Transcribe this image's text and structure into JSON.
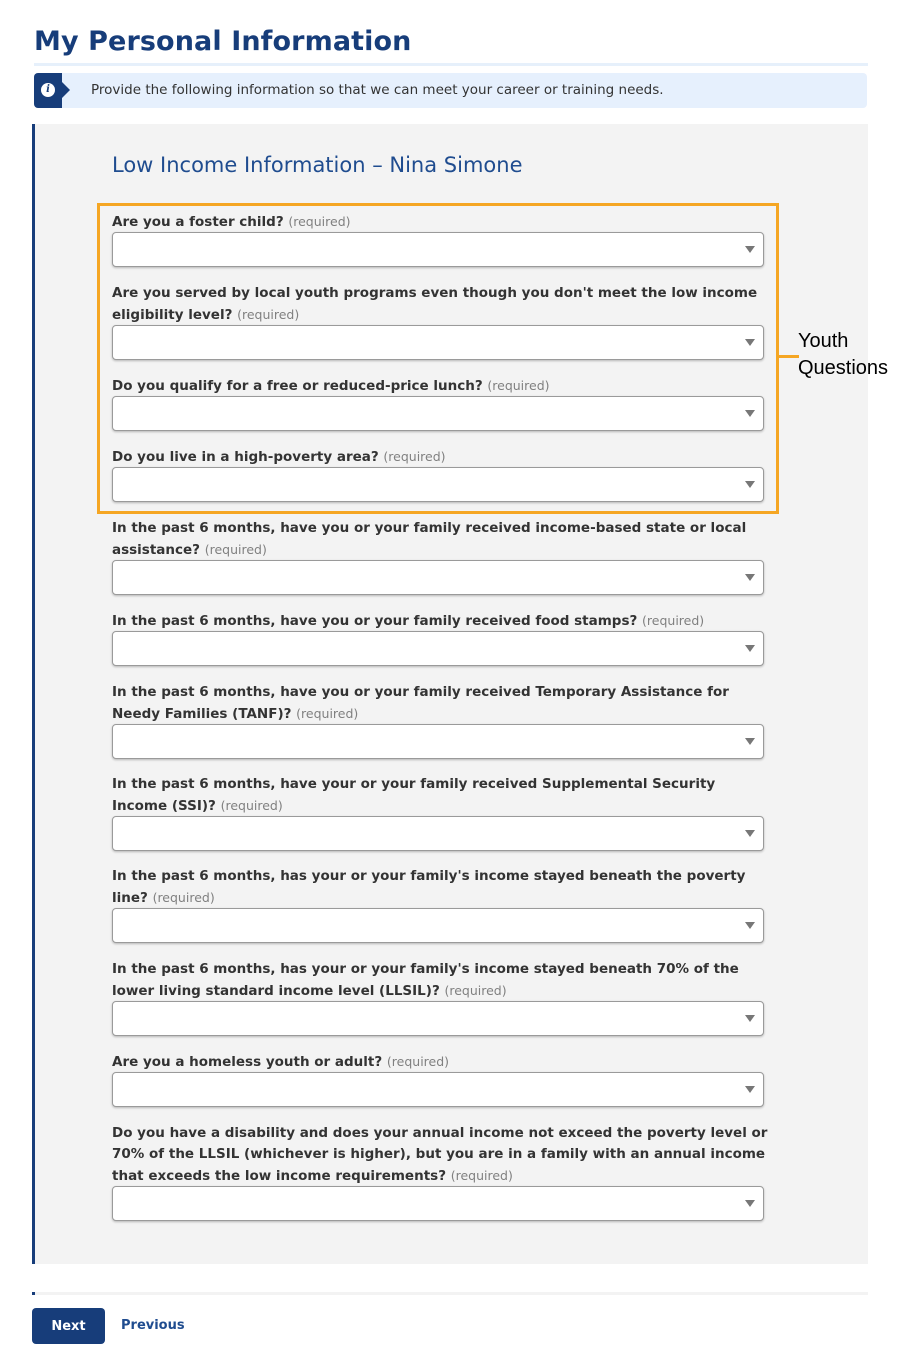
{
  "page": {
    "title": "My Personal Information"
  },
  "info_banner": {
    "icon": "info-icon",
    "icon_glyph": "i",
    "text": "Provide the following information so that we can meet your career or training needs."
  },
  "section": {
    "title": "Low Income Information – Nina Simone"
  },
  "annotation": {
    "line1": "Youth",
    "line2": "Questions",
    "color": "#f5a623"
  },
  "questions": [
    {
      "label": "Are you a foster child?",
      "required": "(required)",
      "value": "",
      "youth": true
    },
    {
      "label": "Are you served by local youth programs even though you don't meet the low income eligibility level?",
      "required": "(required)",
      "value": "",
      "youth": true
    },
    {
      "label": "Do you qualify for a free or reduced-price lunch?",
      "required": "(required)",
      "value": "",
      "youth": true
    },
    {
      "label": "Do you live in a high-poverty area?",
      "required": "(required)",
      "value": "",
      "youth": true
    },
    {
      "label": "In the past 6 months, have you or your family received income-based state or local assistance?",
      "required": "(required)",
      "value": "",
      "youth": false
    },
    {
      "label": "In the past 6 months, have you or your family received food stamps?",
      "required": "(required)",
      "value": "",
      "youth": false
    },
    {
      "label": "In the past 6 months, have you or your family received Temporary Assistance for Needy Families (TANF)?",
      "required": "(required)",
      "value": "",
      "youth": false
    },
    {
      "label": "In the past 6 months, have your or your family received Supplemental Security Income (SSI)?",
      "required": "(required)",
      "value": "",
      "youth": false
    },
    {
      "label": "In the past 6 months, has your or your family's income stayed beneath the poverty line?",
      "required": "(required)",
      "value": "",
      "youth": false
    },
    {
      "label": "In the past 6 months, has your or your family's income stayed beneath 70% of the lower living standard income level (LLSIL)?",
      "required": "(required)",
      "value": "",
      "youth": false
    },
    {
      "label": "Are you a homeless youth or adult?",
      "required": "(required)",
      "value": "",
      "youth": false
    },
    {
      "label": "Do you have a disability and does your annual income not exceed the poverty level or 70% of the LLSIL (whichever is higher), but you are in a family with an annual income that exceeds the low income requirements?",
      "required": "(required)",
      "value": "",
      "youth": false
    }
  ],
  "footer": {
    "next_label": "Next",
    "previous_label": "Previous"
  },
  "colors": {
    "brand": "#173d7a",
    "link": "#1f4c8f",
    "highlight": "#f5a623",
    "banner_bg": "#e6f0fd",
    "panel_bg": "#f3f3f3"
  }
}
